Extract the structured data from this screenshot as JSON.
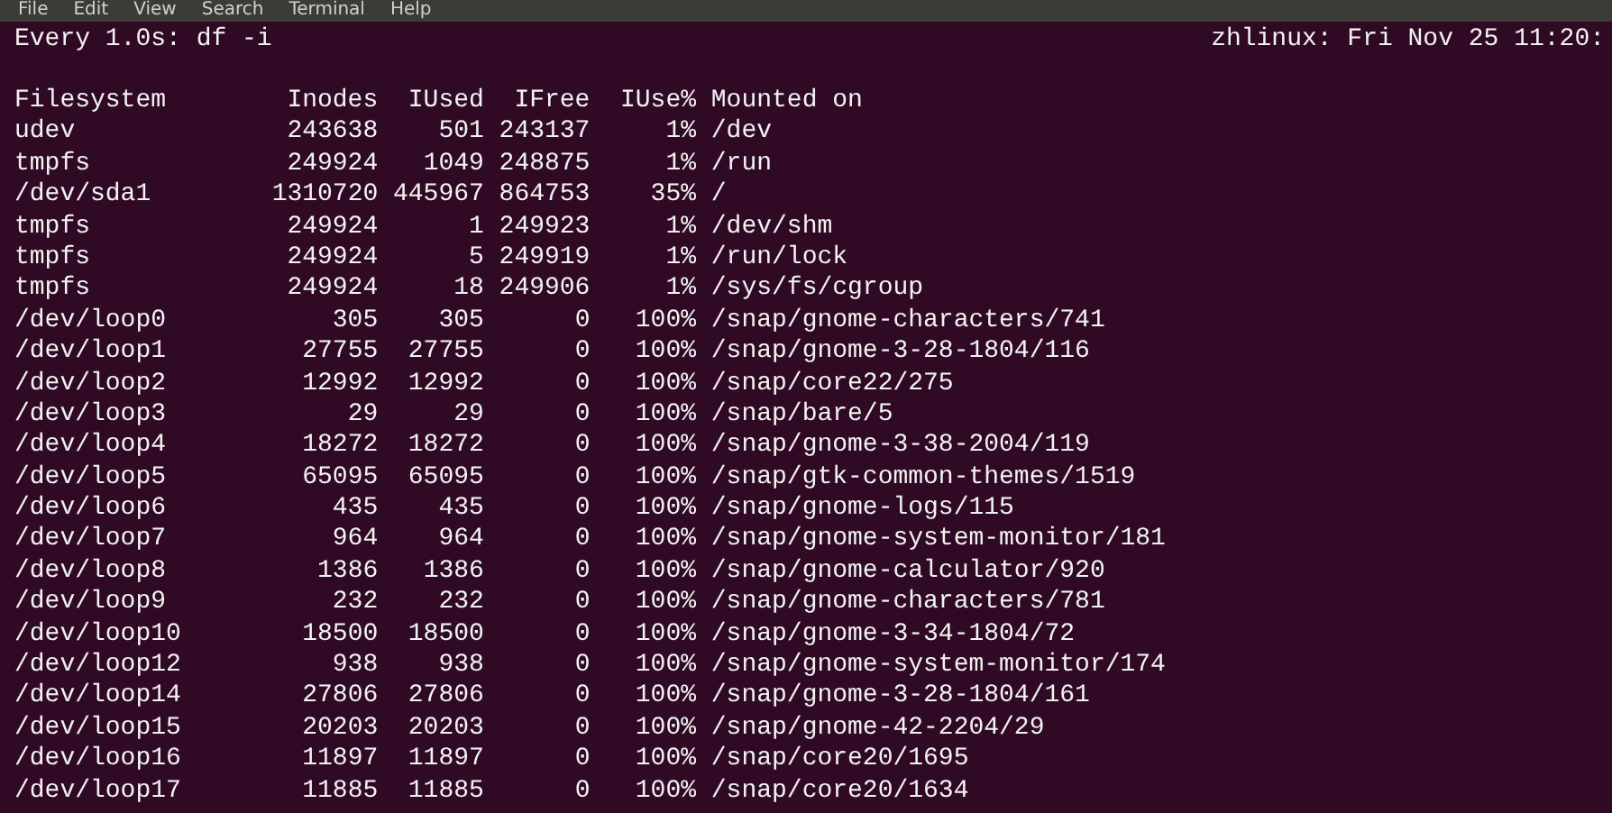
{
  "menu": [
    "File",
    "Edit",
    "View",
    "Search",
    "Terminal",
    "Help"
  ],
  "watch_header": {
    "command": "Every 1.0s: df -i",
    "host_time": "zhlinux: Fri Nov 25 11:20:"
  },
  "table": {
    "columns": [
      "Filesystem",
      "Inodes",
      "IUsed",
      "IFree",
      "IUse%",
      "Mounted on"
    ],
    "rows": [
      [
        "udev",
        "243638",
        "501",
        "243137",
        "1%",
        "/dev"
      ],
      [
        "tmpfs",
        "249924",
        "1049",
        "248875",
        "1%",
        "/run"
      ],
      [
        "/dev/sda1",
        "1310720",
        "445967",
        "864753",
        "35%",
        "/"
      ],
      [
        "tmpfs",
        "249924",
        "1",
        "249923",
        "1%",
        "/dev/shm"
      ],
      [
        "tmpfs",
        "249924",
        "5",
        "249919",
        "1%",
        "/run/lock"
      ],
      [
        "tmpfs",
        "249924",
        "18",
        "249906",
        "1%",
        "/sys/fs/cgroup"
      ],
      [
        "/dev/loop0",
        "305",
        "305",
        "0",
        "100%",
        "/snap/gnome-characters/741"
      ],
      [
        "/dev/loop1",
        "27755",
        "27755",
        "0",
        "100%",
        "/snap/gnome-3-28-1804/116"
      ],
      [
        "/dev/loop2",
        "12992",
        "12992",
        "0",
        "100%",
        "/snap/core22/275"
      ],
      [
        "/dev/loop3",
        "29",
        "29",
        "0",
        "100%",
        "/snap/bare/5"
      ],
      [
        "/dev/loop4",
        "18272",
        "18272",
        "0",
        "100%",
        "/snap/gnome-3-38-2004/119"
      ],
      [
        "/dev/loop5",
        "65095",
        "65095",
        "0",
        "100%",
        "/snap/gtk-common-themes/1519"
      ],
      [
        "/dev/loop6",
        "435",
        "435",
        "0",
        "100%",
        "/snap/gnome-logs/115"
      ],
      [
        "/dev/loop7",
        "964",
        "964",
        "0",
        "100%",
        "/snap/gnome-system-monitor/181"
      ],
      [
        "/dev/loop8",
        "1386",
        "1386",
        "0",
        "100%",
        "/snap/gnome-calculator/920"
      ],
      [
        "/dev/loop9",
        "232",
        "232",
        "0",
        "100%",
        "/snap/gnome-characters/781"
      ],
      [
        "/dev/loop10",
        "18500",
        "18500",
        "0",
        "100%",
        "/snap/gnome-3-34-1804/72"
      ],
      [
        "/dev/loop12",
        "938",
        "938",
        "0",
        "100%",
        "/snap/gnome-system-monitor/174"
      ],
      [
        "/dev/loop14",
        "27806",
        "27806",
        "0",
        "100%",
        "/snap/gnome-3-28-1804/161"
      ],
      [
        "/dev/loop15",
        "20203",
        "20203",
        "0",
        "100%",
        "/snap/gnome-42-2204/29"
      ],
      [
        "/dev/loop16",
        "11897",
        "11897",
        "0",
        "100%",
        "/snap/core20/1695"
      ],
      [
        "/dev/loop17",
        "11885",
        "11885",
        "0",
        "100%",
        "/snap/core20/1634"
      ]
    ]
  }
}
